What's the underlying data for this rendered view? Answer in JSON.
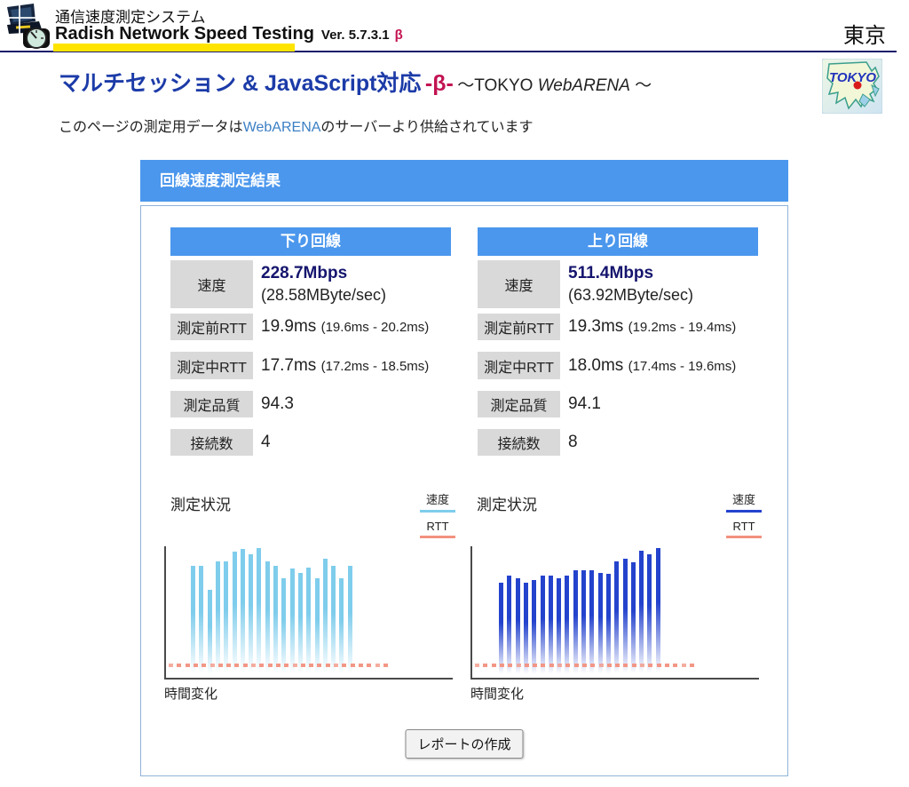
{
  "header": {
    "system_label": "通信速度測定システム",
    "title": "Radish Network Speed Testing",
    "version_label": "Ver. 5.7.3.1",
    "beta_mark": "β",
    "location": "東京"
  },
  "subtitle": {
    "main": "マルチセッション & JavaScript対応",
    "beta": "-β-",
    "suffix_pre": "～TOKYO ",
    "suffix_brand": "WebARENA",
    "suffix_post": " ～"
  },
  "badge": {
    "label": "TOKYO"
  },
  "info": {
    "pre": "このページの測定用データは",
    "link": "WebARENA",
    "post": "のサーバーより供給されています"
  },
  "panel": {
    "title": "回線速度測定結果",
    "report_button": "レポートの作成"
  },
  "tables": [
    {
      "title": "下り回線",
      "speed_label": "速度",
      "speed_value": "228.7Mbps",
      "speed_sub": "(28.58MByte/sec)",
      "rtt_before_label": "測定前RTT",
      "rtt_before_value": "19.9ms",
      "rtt_before_range": "(19.6ms - 20.2ms)",
      "rtt_during_label": "測定中RTT",
      "rtt_during_value": "17.7ms",
      "rtt_during_range": "(17.2ms - 18.5ms)",
      "quality_label": "測定品質",
      "quality_value": "94.3",
      "connections_label": "接続数",
      "connections_value": "4"
    },
    {
      "title": "上り回線",
      "speed_label": "速度",
      "speed_value": "511.4Mbps",
      "speed_sub": "(63.92MByte/sec)",
      "rtt_before_label": "測定前RTT",
      "rtt_before_value": "19.3ms",
      "rtt_before_range": "(19.2ms - 19.4ms)",
      "rtt_during_label": "測定中RTT",
      "rtt_during_value": "18.0ms",
      "rtt_during_range": "(17.4ms - 19.6ms)",
      "quality_label": "測定品質",
      "quality_value": "94.1",
      "connections_label": "接続数",
      "connections_value": "8"
    }
  ],
  "chart_data": [
    {
      "type": "bar",
      "section_label": "測定状況",
      "xlabel": "時間変化",
      "legend": [
        {
          "label": "速度",
          "color": "#7fcdec"
        },
        {
          "label": "RTT",
          "color": "#f2917f"
        }
      ],
      "bar_color": "#7fcdec",
      "rtt_color": "#f2917f",
      "values": [
        0.86,
        0.86,
        0.68,
        0.9,
        0.9,
        0.97,
        0.99,
        0.95,
        1.0,
        0.9,
        0.86,
        0.77,
        0.84,
        0.81,
        0.85,
        0.77,
        0.92,
        0.86,
        0.77,
        0.86
      ],
      "rtt_marks": 27,
      "bar_start": 28,
      "note": "download speed per time step, normalized to peak; RTT shown as low flat marks"
    },
    {
      "type": "bar",
      "section_label": "測定状況",
      "xlabel": "時間変化",
      "legend": [
        {
          "label": "速度",
          "color": "#2443cd"
        },
        {
          "label": "RTT",
          "color": "#f2917f"
        }
      ],
      "bar_color": "#2443cd",
      "rtt_color": "#f2917f",
      "values": [
        0.73,
        0.79,
        0.77,
        0.73,
        0.75,
        0.79,
        0.79,
        0.77,
        0.79,
        0.83,
        0.83,
        0.83,
        0.81,
        0.8,
        0.9,
        0.92,
        0.89,
        0.98,
        0.95,
        1.0
      ],
      "rtt_marks": 27,
      "bar_start": 30,
      "note": "upload speed per time step, normalized to peak; RTT shown as low flat marks"
    }
  ]
}
